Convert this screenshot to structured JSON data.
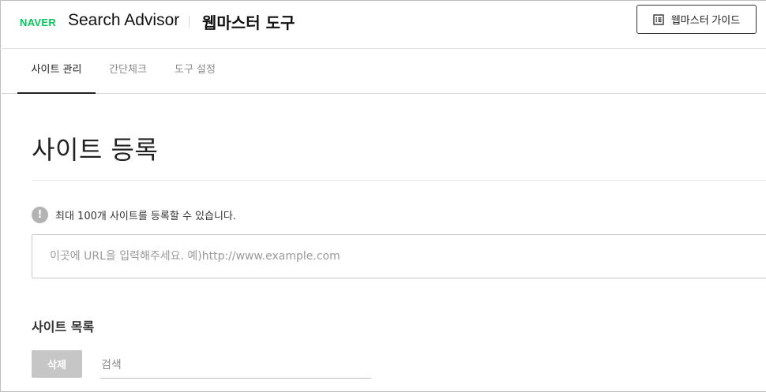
{
  "header": {
    "logo": "NAVER",
    "product_name": "Search Advisor",
    "tool_title": "웹마스터 도구",
    "guide_button": {
      "label": "웹마스터 가이드",
      "icon": "list-document-icon"
    }
  },
  "tabs": [
    {
      "label": "사이트 관리",
      "active": true
    },
    {
      "label": "간단체크",
      "active": false
    },
    {
      "label": "도구 설정",
      "active": false
    }
  ],
  "main": {
    "title": "사이트 등록",
    "notice": {
      "icon": "info-icon",
      "icon_glyph": "!",
      "text": "최대 100개 사이트를 등록할 수 있습니다."
    },
    "url_input": {
      "value": "",
      "placeholder": "이곳에 URL을 입력해주세요. 예)http://www.example.com"
    },
    "site_list": {
      "title": "사이트 목록",
      "delete_button": "삭제",
      "search": {
        "value": "",
        "placeholder": "검색"
      }
    }
  },
  "colors": {
    "brand_green": "#03c75a",
    "active_tab": "#222222",
    "disabled_button": "#c6c6c6"
  }
}
